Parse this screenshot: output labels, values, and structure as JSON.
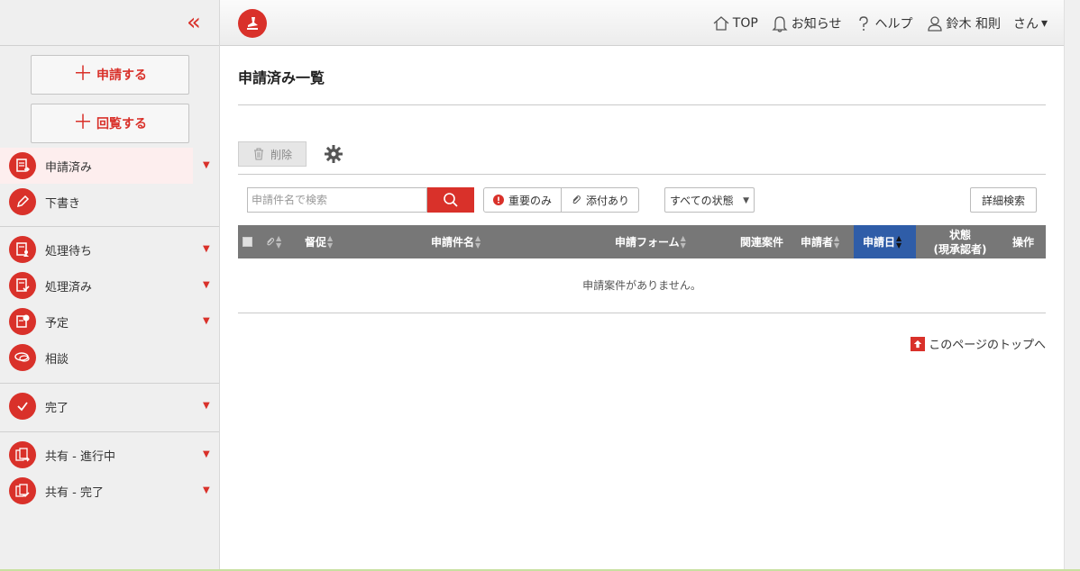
{
  "sidebar": {
    "collapse_icon": "double-chevron-left-icon",
    "apply_label": "申請する",
    "circulate_label": "回覧する",
    "items": [
      {
        "label": "申請済み",
        "icon": "document-arrow-icon",
        "has_arrow": true,
        "active": true
      },
      {
        "label": "下書き",
        "icon": "pencil-icon",
        "has_arrow": false
      },
      {
        "label": "処理待ち",
        "icon": "document-person-icon",
        "has_arrow": true
      },
      {
        "label": "処理済み",
        "icon": "document-check-icon",
        "has_arrow": true
      },
      {
        "label": "予定",
        "icon": "document-clock-icon",
        "has_arrow": true
      },
      {
        "label": "相談",
        "icon": "chat-bubble-icon",
        "has_arrow": false
      },
      {
        "label": "完了",
        "icon": "checkmark-icon",
        "has_arrow": true
      },
      {
        "label": "共有 - 進行中",
        "icon": "shared-docs-icon",
        "has_arrow": true
      },
      {
        "label": "共有 - 完了",
        "icon": "shared-docs-check-icon",
        "has_arrow": true
      }
    ],
    "arrow_glyph": "▼"
  },
  "header": {
    "top_label": "TOP",
    "notice_label": "お知らせ",
    "help_label": "ヘルプ",
    "user_label": "鈴木 和則　さん",
    "user_caret": "▾"
  },
  "main": {
    "title": "申請済み一覧",
    "delete_label": "削除",
    "search_placeholder": "申請件名で検索",
    "filter_important": "重要のみ",
    "filter_attachment": "添付あり",
    "status_select": "すべての状態",
    "advanced_search": "詳細検索",
    "columns": {
      "urge": "督促",
      "subject": "申請件名",
      "form": "申請フォーム",
      "related": "関連案件",
      "applicant": "申請者",
      "date": "申請日",
      "status_line1": "状態",
      "status_line2": "(現承認者)",
      "action": "操作"
    },
    "empty_message": "申請案件がありません。",
    "page_top": "このページのトップへ"
  },
  "colors": {
    "accent": "#d9312a",
    "table_header": "#777777",
    "sorted_header": "#2f5da8",
    "sidebar_bg": "#efefef",
    "active_item_bg": "#fdeeee"
  }
}
